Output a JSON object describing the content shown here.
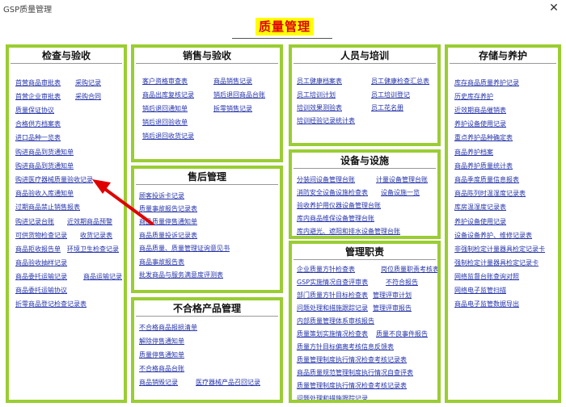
{
  "window": {
    "title": "GSP质量管理",
    "close_glyph": "✕"
  },
  "main_title": "质量管理",
  "panels": {
    "check": {
      "title": "检查与验收",
      "links": [
        "首营商品审批表",
        "采购记录",
        "首营企业审批表",
        "采购合同",
        "质量保证协议",
        "合格供方档案表",
        "进口品种一览表",
        "购进商品到货通知单",
        "购进商品到货通知单",
        "购进医疗器械质量验收记录",
        "商品验收入库通知单",
        "过期商品禁止销售报表",
        "购进记录台账",
        "近效期商品预警",
        "可供货物检查记录",
        "收货记录表",
        "商品拒收报告单",
        "环境卫生检查记录",
        "商品验收抽样记录",
        "商品委托运输记录",
        "商品运输记录",
        "商品委托运输协议",
        "折零商品登记检查记录表"
      ]
    },
    "sales": {
      "title": "销售与验收",
      "links": [
        "客户资格审查表",
        "商品销售记录",
        "商品出库复核记录",
        "销后退回商品台账",
        "销后退回通知单",
        "拆零销售记录",
        "销后退回验收单",
        "销后退回收货记录"
      ]
    },
    "after": {
      "title": "售后管理",
      "links": [
        "顾客投诉卡记录",
        "质量事故报告记录表",
        "商品质量停售通知单",
        "商品质量投诉记录表",
        "商品质量、质量管理证询意见书",
        "商品事故报告表",
        "批发商品与服务满意度评测表"
      ]
    },
    "unqual": {
      "title": "不合格产品管理",
      "links": [
        "不合格商品报损清单",
        "解除停售通知单",
        "质量停售通知单",
        "不合格商品台账",
        "商品销毁记录",
        "医疗器械产品召回记录"
      ]
    },
    "staff": {
      "title": "人员与培训",
      "links": [
        "员工健康档案表",
        "员工健康检查汇总表",
        "员工培训计划",
        "员工培训登记",
        "培训效果测验表",
        "员工花名册",
        "培训经验记录统计表"
      ]
    },
    "equip": {
      "title": "设备与设施",
      "links": [
        "分装间设备管理台账",
        "计量设备管理台账",
        "消防安全设备设施检查表",
        "设备设施一览",
        "验收养护用仪器设备管理台账",
        "库内商品维保设备管理台账",
        "库内避光、遮阳和排水设备管理台账"
      ]
    },
    "duty": {
      "title": "管理职责",
      "links": [
        "企业质量方针检查表",
        "岗位质量职责考核表",
        "GSP实施情况自查评审表",
        "不符合报告",
        "部门质量方针目标检查表",
        "管理评审计划",
        "问题处理和措施跟踪记录",
        "管理评审报告",
        "内部质量管理体系审核报告",
        "质量策划实施情况检查表",
        "质量不良事件报告",
        "质量方针目标偏离考核信息反馈表",
        "质量管理制度执行情况检查考核记录表",
        "商品质量规范管理制度执行情况自查评表",
        "质量管理制度执行情况检查考核记录表",
        "问题处理和措施跟踪记录"
      ]
    },
    "storage": {
      "title": "存储与养护",
      "links": [
        "库存商品质量养护记录",
        "历史库存养护",
        "近效期商品催销表",
        "养护设备使用记录",
        "重点养护品种确定表",
        "商品养护档案",
        "商品养护质量统计表",
        "商品季度质量信息报表",
        "商品陈列时温湿度记录表",
        "库房温湿度记录表",
        "养护设备使用记录",
        "设备设备养护、维修记录表",
        "非强制检定计量器具检定记录卡",
        "强制检定计量器具检定记录卡",
        "网络监督台账查询对照",
        "网络电子监管扫描",
        "商品电子监管数据导出"
      ]
    }
  },
  "colors": {
    "panel_border": "#9acd32",
    "link": "#2433aa",
    "title_bg": "#ffff00",
    "title_text": "#e00000",
    "arrow": "#e00000"
  }
}
